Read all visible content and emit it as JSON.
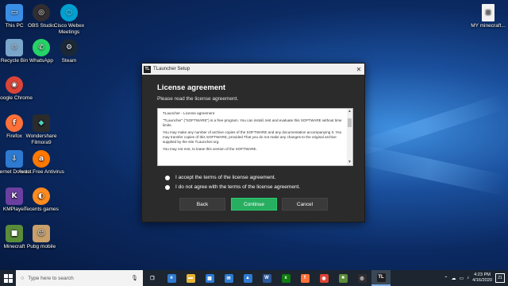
{
  "desktop": {
    "icons": [
      {
        "label": "This PC",
        "icon": "this-pc-icon",
        "color": "#3a8ee6"
      },
      {
        "label": "OBS Studio",
        "icon": "obs-icon",
        "color": "#302e31"
      },
      {
        "label": "Cisco Webex Meetings",
        "icon": "webex-icon",
        "color": "#00a0d1"
      },
      {
        "label": "Recycle Bin",
        "icon": "recycle-bin-icon",
        "color": "#7aa6c9"
      },
      {
        "label": "WhatsApp",
        "icon": "whatsapp-icon",
        "color": "#25d366"
      },
      {
        "label": "Steam",
        "icon": "steam-icon",
        "color": "#1b2838"
      },
      {
        "label": "Google Chrome",
        "icon": "chrome-icon",
        "color": "#db4437"
      },
      {
        "label": "Firefox",
        "icon": "firefox-icon",
        "color": "#ff7139"
      },
      {
        "label": "Wondershare Filmora9",
        "icon": "filmora-icon",
        "color": "#2b2b2b"
      },
      {
        "label": "Internet Downlo...",
        "icon": "idm-icon",
        "color": "#2e7ad1"
      },
      {
        "label": "Avast Free Antivirus",
        "icon": "avast-icon",
        "color": "#ff7800"
      },
      {
        "label": "KMPlayer",
        "icon": "kmplayer-icon",
        "color": "#6b3fa0"
      },
      {
        "label": "Tecents games",
        "icon": "tencent-games-icon",
        "color": "#ff8a1e"
      },
      {
        "label": "Minecraft",
        "icon": "minecraft-icon",
        "color": "#5b8c3a"
      },
      {
        "label": "Pubg mobile",
        "icon": "pubg-icon",
        "color": "#c9a06a"
      },
      {
        "label": "MY minecraft...",
        "icon": "document-icon",
        "color": "#f2f2f2"
      }
    ]
  },
  "dialog": {
    "window_title": "TLauncher Setup",
    "app_icon_text": "TL",
    "close_glyph": "✕",
    "heading": "License agreement",
    "subheading": "Please read the license agreement.",
    "license_paragraphs": [
      "TLauncher - License agreement",
      "\"TLauncher\" (\"SOFTWARE\") is a free program. You can install, test and evaluate this SOFTWARE without time limits.",
      "You may make any number of archive copies of the SOFTWARE and any documentation accompanying it. You may transfer copies of this SOFTWARE, provided That you do not make any changes to the original archive supplied by the site TLauncher.org.",
      "You may not rent, to lease this version of the SOFTWARE."
    ],
    "accept_label": "I accept the terms of the license agreement.",
    "decline_label": "I do not agree with the terms of the license agreement.",
    "accept_selected": false,
    "back_label": "Back",
    "continue_label": "Continue",
    "cancel_label": "Cancel"
  },
  "taskbar": {
    "search_placeholder": "Type here to search",
    "pinned": [
      {
        "icon": "task-view-icon",
        "glyph": "❐",
        "color": "transparent"
      },
      {
        "icon": "edge-icon",
        "glyph": "e",
        "color": "#2e7ad1"
      },
      {
        "icon": "file-explorer-icon",
        "glyph": "▬",
        "color": "#e8b533"
      },
      {
        "icon": "store-icon",
        "glyph": "▦",
        "color": "#2e7ad1"
      },
      {
        "icon": "mail-icon",
        "glyph": "✉",
        "color": "#2e7ad1"
      },
      {
        "icon": "photos-icon",
        "glyph": "▲",
        "color": "#2e7ad1"
      },
      {
        "icon": "word-icon",
        "glyph": "W",
        "color": "#2b579a"
      },
      {
        "icon": "xbox-icon",
        "glyph": "x",
        "color": "#107c10"
      },
      {
        "icon": "firefox-icon",
        "glyph": "f",
        "color": "#ff7139"
      },
      {
        "icon": "chrome-icon",
        "glyph": "◉",
        "color": "#db4437"
      },
      {
        "icon": "minecraft-icon",
        "glyph": "■",
        "color": "#5b8c3a"
      },
      {
        "icon": "obs-icon",
        "glyph": "◎",
        "color": "#302e31"
      }
    ],
    "active_app": "TL",
    "tray_glyphs": [
      "⌃",
      "☁",
      "▭",
      "♪"
    ],
    "time": "4:23 PM",
    "date": "4/16/2020",
    "notification_count": "21"
  }
}
